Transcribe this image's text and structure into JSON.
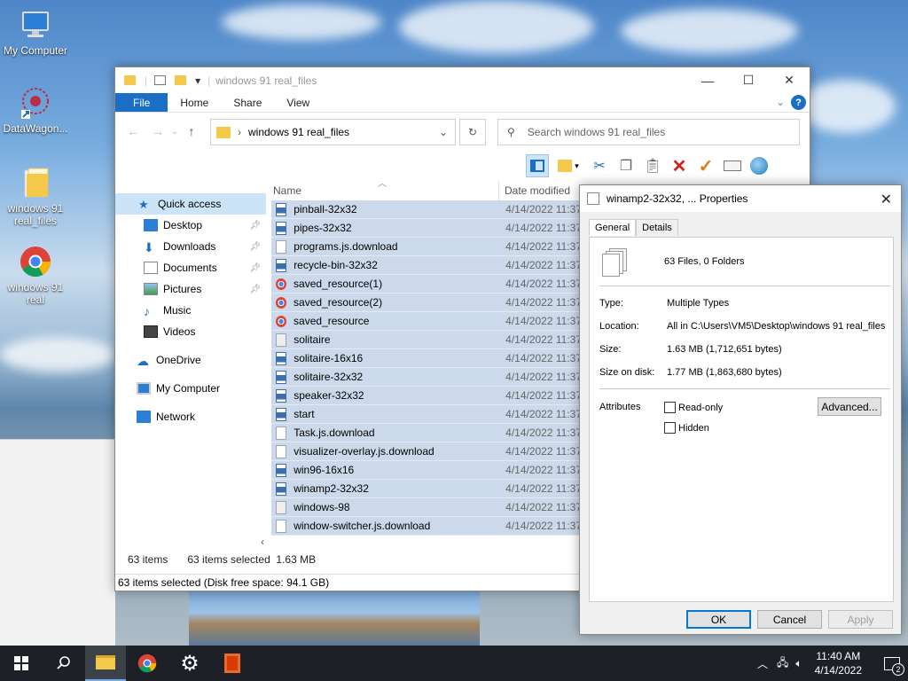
{
  "desktop": {
    "icons": [
      {
        "label": "My Computer",
        "icon": "monitor-icon"
      },
      {
        "label": "DataWagon...",
        "icon": "app-shortcut-icon"
      },
      {
        "label": "windows 91 real_files",
        "icon": "folder-icon"
      },
      {
        "label": "windows 91 real",
        "icon": "chrome-icon"
      }
    ]
  },
  "explorer": {
    "title": "windows 91 real_files",
    "ribbon_tabs": [
      "File",
      "Home",
      "Share",
      "View"
    ],
    "address": "windows 91 real_files",
    "search_placeholder": "Search windows 91 real_files",
    "nav": {
      "quick_access": "Quick access",
      "pinned": [
        "Desktop",
        "Downloads",
        "Documents",
        "Pictures"
      ],
      "others": [
        "Music",
        "Videos"
      ],
      "onedrive": "OneDrive",
      "my_computer": "My Computer",
      "network": "Network"
    },
    "columns": {
      "name": "Name",
      "date": "Date modified"
    },
    "files": [
      {
        "name": "pinball-32x32",
        "type": "image",
        "date": "4/14/2022 11:37"
      },
      {
        "name": "pipes-32x32",
        "type": "image",
        "date": "4/14/2022 11:37"
      },
      {
        "name": "programs.js.download",
        "type": "file",
        "date": "4/14/2022 11:37"
      },
      {
        "name": "recycle-bin-32x32",
        "type": "image",
        "date": "4/14/2022 11:37"
      },
      {
        "name": "saved_resource(1)",
        "type": "chrome",
        "date": "4/14/2022 11:37"
      },
      {
        "name": "saved_resource(2)",
        "type": "chrome",
        "date": "4/14/2022 11:37"
      },
      {
        "name": "saved_resource",
        "type": "chrome",
        "date": "4/14/2022 11:37"
      },
      {
        "name": "solitaire",
        "type": "gear",
        "date": "4/14/2022 11:37"
      },
      {
        "name": "solitaire-16x16",
        "type": "image",
        "date": "4/14/2022 11:37"
      },
      {
        "name": "solitaire-32x32",
        "type": "image",
        "date": "4/14/2022 11:37"
      },
      {
        "name": "speaker-32x32",
        "type": "image",
        "date": "4/14/2022 11:37"
      },
      {
        "name": "start",
        "type": "image",
        "date": "4/14/2022 11:37"
      },
      {
        "name": "Task.js.download",
        "type": "file",
        "date": "4/14/2022 11:37"
      },
      {
        "name": "visualizer-overlay.js.download",
        "type": "file",
        "date": "4/14/2022 11:37"
      },
      {
        "name": "win96-16x16",
        "type": "image",
        "date": "4/14/2022 11:37"
      },
      {
        "name": "winamp2-32x32",
        "type": "image",
        "date": "4/14/2022 11:37"
      },
      {
        "name": "windows-98",
        "type": "gear",
        "date": "4/14/2022 11:37"
      },
      {
        "name": "window-switcher.js.download",
        "type": "file",
        "date": "4/14/2022 11:37"
      }
    ],
    "status": {
      "items": "63 items",
      "selected": "63 items selected",
      "size": "1.63 MB"
    },
    "status_bar": "63 items selected (Disk free space: 94.1 GB)"
  },
  "properties": {
    "title": "winamp2-32x32, ... Properties",
    "tabs": [
      "General",
      "Details"
    ],
    "summary": "63 Files, 0 Folders",
    "type_label": "Type:",
    "type_value": "Multiple Types",
    "location_label": "Location:",
    "location_value": "All in C:\\Users\\VM5\\Desktop\\windows 91 real_files",
    "size_label": "Size:",
    "size_value": "1.63 MB (1,712,651 bytes)",
    "size_on_disk_label": "Size on disk:",
    "size_on_disk_value": "1.77 MB (1,863,680 bytes)",
    "attributes_label": "Attributes",
    "readonly_label": "Read-only",
    "hidden_label": "Hidden",
    "advanced_label": "Advanced...",
    "ok_label": "OK",
    "cancel_label": "Cancel",
    "apply_label": "Apply"
  },
  "taskbar": {
    "time": "11:40 AM",
    "date": "4/14/2022",
    "notifications": "2"
  },
  "colors": {
    "accent": "#1a6fc4",
    "selection": "#ccd9ea",
    "taskbar": "#1d2027"
  }
}
